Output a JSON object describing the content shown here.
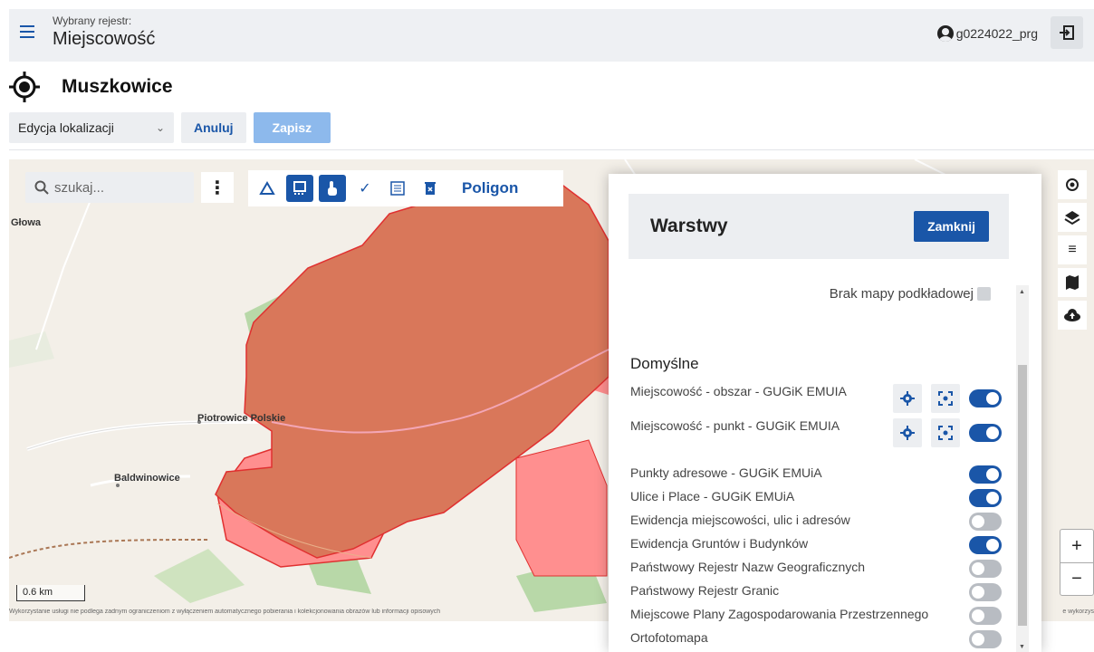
{
  "header": {
    "registry_label": "Wybrany rejestr:",
    "registry_value": "Miejscowość",
    "username": "g0224022_prg"
  },
  "page": {
    "title": "Muszkowice"
  },
  "toolbar": {
    "mode_select": "Edycja lokalizacji",
    "cancel_label": "Anuluj",
    "save_label": "Zapisz"
  },
  "map": {
    "search_placeholder": "szukaj...",
    "draw_mode_label": "Poligon",
    "places": [
      "Głowa",
      "Piotrowice Polskie",
      "Baldwinowice"
    ],
    "scale_label": "0.6 km",
    "attribution": "Wykorzystanie usługi nie podlega żadnym ograniczeniom z wyłączeniem automatycznego pobierania i kolekcjonowania obrazów lub informacji opisowych",
    "attribution_right": "e wykorzys"
  },
  "layers_panel": {
    "title": "Warstwy",
    "close_label": "Zamknij",
    "no_basemap_label": "Brak mapy podkładowej",
    "section_title": "Domyślne",
    "layers": [
      {
        "name": "Miejscowość - obszar - GUGiK EMUIA",
        "on": true,
        "has_tools": true
      },
      {
        "name": "Miejscowość - punkt - GUGiK EMUIA",
        "on": true,
        "has_tools": true
      },
      {
        "name": "Punkty adresowe - GUGiK EMUiA",
        "on": true,
        "has_tools": false
      },
      {
        "name": "Ulice i Place - GUGiK EMUiA",
        "on": true,
        "has_tools": false
      },
      {
        "name": "Ewidencja miejscowości, ulic i adresów",
        "on": false,
        "has_tools": false
      },
      {
        "name": "Ewidencja Gruntów i Budynków",
        "on": true,
        "has_tools": false
      },
      {
        "name": "Państwowy Rejestr Nazw Geograficznych",
        "on": false,
        "has_tools": false
      },
      {
        "name": "Państwowy Rejestr Granic",
        "on": false,
        "has_tools": false
      },
      {
        "name": "Miejscowe Plany Zagospodarowania Przestrzennego",
        "on": false,
        "has_tools": false
      },
      {
        "name": "Ortofotomapa",
        "on": false,
        "has_tools": false
      }
    ]
  },
  "colors": {
    "accent": "#1a56a8",
    "polygon_fill": "#d9775a",
    "area_fill": "#ff8f8f",
    "border": "#e03030"
  }
}
